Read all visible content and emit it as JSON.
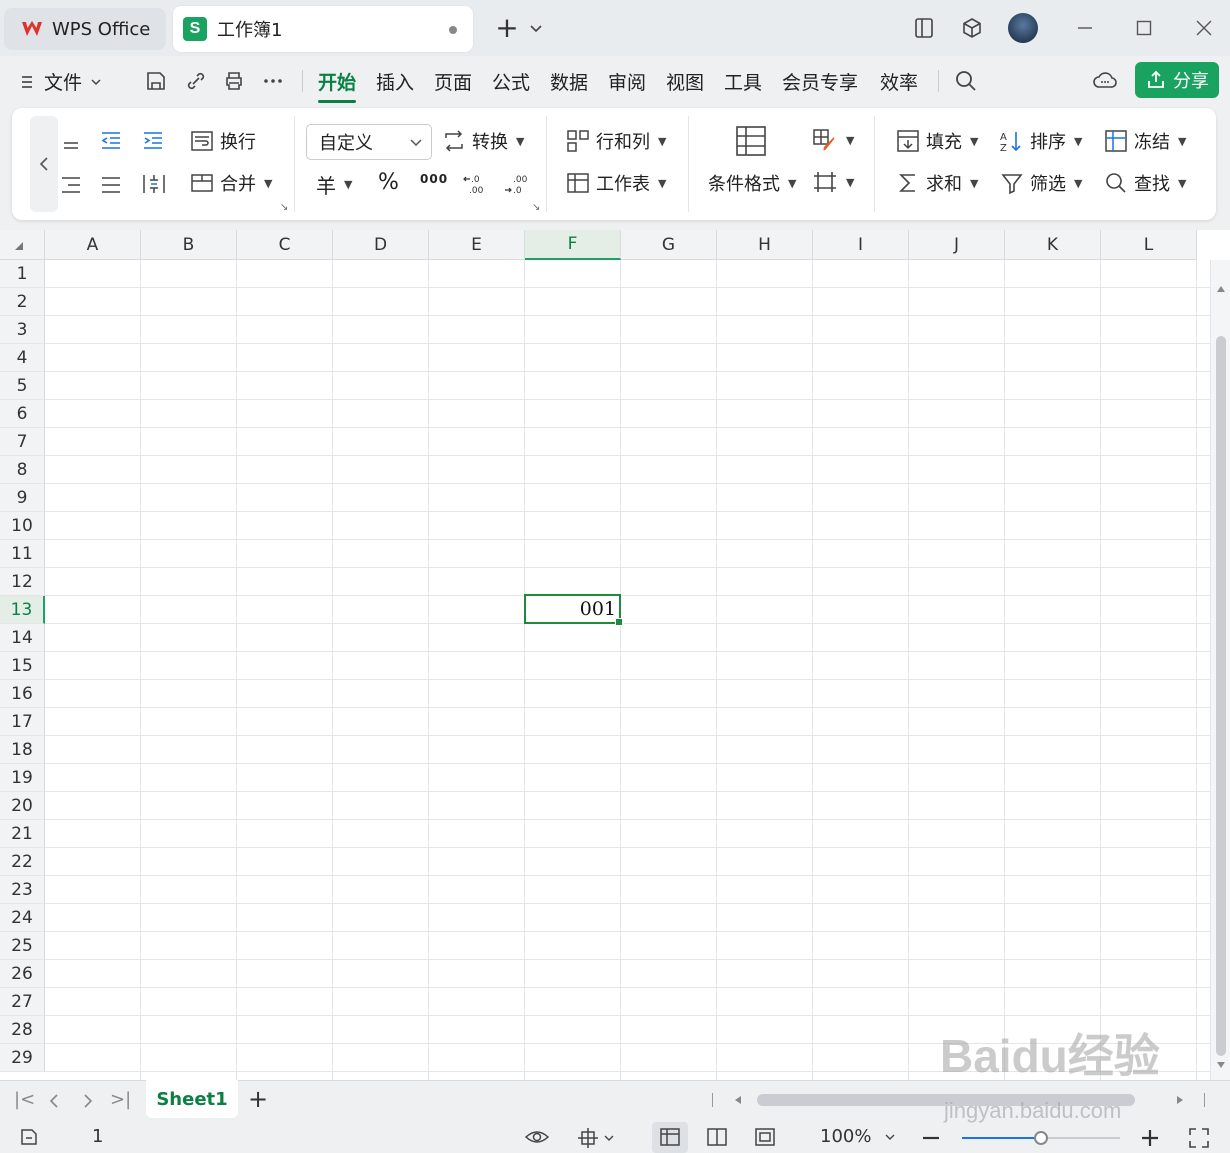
{
  "titlebar": {
    "app_tab_label": "WPS Office",
    "doc_tab_label": "工作簿1",
    "doc_tab_icon_letter": "S",
    "new_tab_symbol": "+"
  },
  "menu": {
    "file_label": "文件",
    "tabs": [
      {
        "label": "开始",
        "active": true
      },
      {
        "label": "插入"
      },
      {
        "label": "页面"
      },
      {
        "label": "公式"
      },
      {
        "label": "数据"
      },
      {
        "label": "审阅"
      },
      {
        "label": "视图"
      },
      {
        "label": "工具"
      },
      {
        "label": "会员专享"
      },
      {
        "label": "效率"
      }
    ],
    "share_label": "分享"
  },
  "ribbon": {
    "wrap_label": "换行",
    "merge_label": "合并",
    "number_format_value": "自定义",
    "convert_label": "转换",
    "currency_symbol": "羊",
    "percent_symbol": "%",
    "thousands_symbol": "000",
    "rows_cols_label": "行和列",
    "worksheet_label": "工作表",
    "cond_format_label": "条件格式",
    "fill_label": "填充",
    "sort_label": "排序",
    "freeze_label": "冻结",
    "sum_label": "求和",
    "filter_label": "筛选",
    "find_label": "查找"
  },
  "sheet": {
    "columns": [
      "A",
      "B",
      "C",
      "D",
      "E",
      "F",
      "G",
      "H",
      "I",
      "J",
      "K",
      "L"
    ],
    "rows": [
      "1",
      "2",
      "3",
      "4",
      "5",
      "6",
      "7",
      "8",
      "9",
      "10",
      "11",
      "12",
      "13",
      "14",
      "15",
      "16",
      "17",
      "18",
      "19",
      "20",
      "21",
      "22",
      "23",
      "24",
      "25",
      "26",
      "27",
      "28",
      "29"
    ],
    "selected_column": "F",
    "selected_row": "13",
    "active_cell": {
      "ref": "F13",
      "value": "001"
    }
  },
  "tabbar": {
    "sheet_name": "Sheet1",
    "add_sheet_symbol": "+"
  },
  "statusbar": {
    "cell_value": "1",
    "zoom": "100%",
    "zoom_fraction": 0.5
  },
  "watermark": {
    "brand": "Baidu经验",
    "url": "jingyan.baidu.com"
  },
  "colors": {
    "accent": "#1aa360",
    "active_tab_text": "#0b8043",
    "selection_border": "#1f8a3c"
  }
}
